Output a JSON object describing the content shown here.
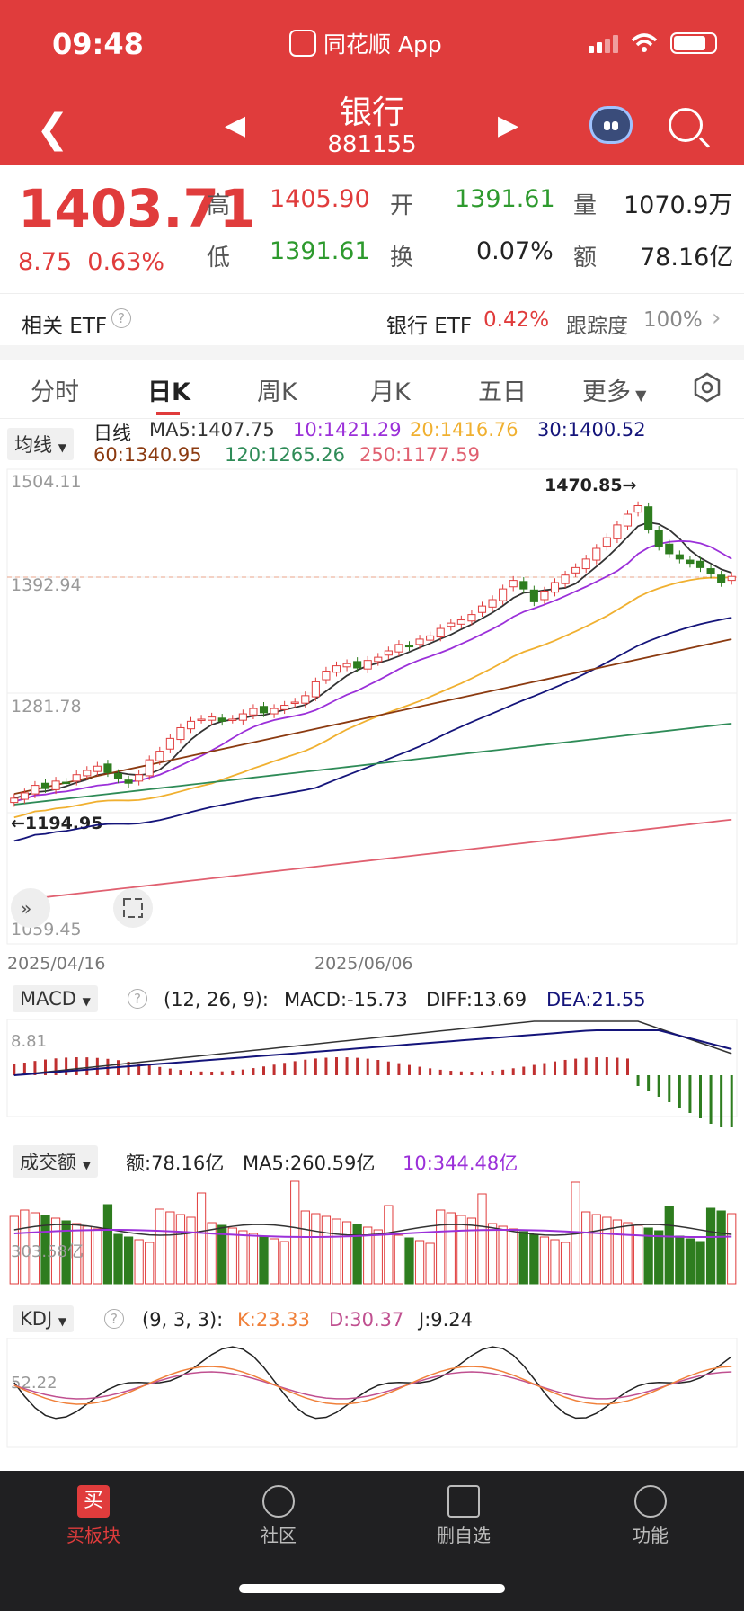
{
  "status": {
    "time": "09:48",
    "app": "同花顺 App"
  },
  "nav": {
    "title": "银行",
    "code": "881155"
  },
  "quote": {
    "price": "1403.71",
    "change": "8.75",
    "change_pct": "0.63%",
    "high_label": "高",
    "high": "1405.90",
    "open_label": "开",
    "open": "1391.61",
    "vol_label": "量",
    "vol": "1070.9万",
    "low_label": "低",
    "low": "1391.61",
    "turnover_label": "换",
    "turnover": "0.07%",
    "amount_label": "额",
    "amount": "78.16亿"
  },
  "etf": {
    "label": "相关 ETF",
    "name": "银行 ETF",
    "pct": "0.42%",
    "track_label": "跟踪度",
    "track": "100%"
  },
  "tabs": [
    "分时",
    "日K",
    "周K",
    "月K",
    "五日",
    "更多"
  ],
  "ma": {
    "selector": "均线",
    "period": "日线",
    "ma5": "MA5:1407.75",
    "ma10": "10:1421.29",
    "ma20": "20:1416.76",
    "ma30": "30:1400.52",
    "ma60": "60:1340.95",
    "ma120": "120:1265.26",
    "ma250": "250:1177.59"
  },
  "kline_axis": {
    "y1": "1504.11",
    "y2": "1392.94",
    "y3": "1281.78",
    "y4": "1059.45",
    "date_start": "2025/04/16",
    "date_mid": "2025/06/06",
    "high_mark": "1470.85→",
    "low_mark": "←1194.95"
  },
  "macd": {
    "selector": "MACD",
    "params": "(12, 26, 9):",
    "macd": "MACD:-15.73",
    "diff": "DIFF:13.69",
    "dea": "DEA:21.55",
    "axis": "8.81"
  },
  "amount_panel": {
    "selector": "成交额",
    "amount": "额:78.16亿",
    "ma5": "MA5:260.59亿",
    "ma10": "10:344.48亿",
    "axis": "303.58亿"
  },
  "kdj": {
    "selector": "KDJ",
    "params": "(9, 3, 3):",
    "k": "K:23.33",
    "d": "D:30.37",
    "j": "J:9.24",
    "axis": "52.22"
  },
  "bottom_nav": [
    "买板块",
    "社区",
    "删自选",
    "功能"
  ],
  "colors": {
    "up": "#e03c3c",
    "down": "#2e7d1f",
    "ma5": "#333333",
    "ma10": "#9b30d9",
    "ma20": "#f0b030",
    "ma30": "#14147a",
    "ma60": "#8b3a10",
    "ma120": "#2e8b57",
    "ma250": "#e06070"
  },
  "chart_data": {
    "type": "candlestick",
    "closes": [
      1196,
      1201,
      1208,
      1205,
      1212,
      1210,
      1218,
      1222,
      1226,
      1220,
      1214,
      1210,
      1218,
      1232,
      1240,
      1252,
      1262,
      1268,
      1270,
      1272,
      1268,
      1270,
      1275,
      1280,
      1276,
      1280,
      1283,
      1286,
      1292,
      1305,
      1315,
      1320,
      1322,
      1318,
      1325,
      1328,
      1334,
      1340,
      1338,
      1345,
      1348,
      1355,
      1360,
      1363,
      1368,
      1376,
      1382,
      1392,
      1400,
      1392,
      1380,
      1390,
      1398,
      1405,
      1412,
      1420,
      1430,
      1440,
      1452,
      1462,
      1470,
      1448,
      1432,
      1425,
      1420,
      1416,
      1412,
      1406,
      1398,
      1403.71
    ],
    "ylim": [
      1059.45,
      1504.11
    ]
  }
}
